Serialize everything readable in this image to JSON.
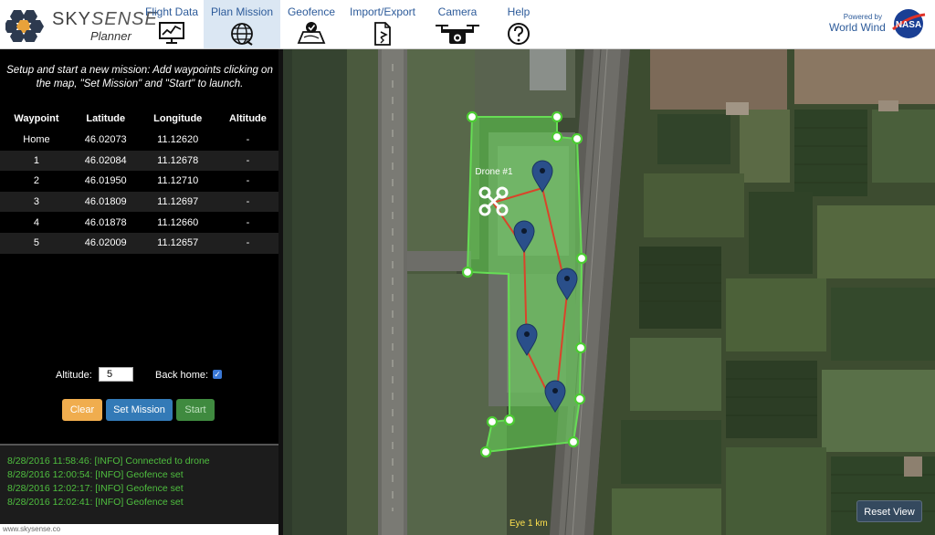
{
  "logo": {
    "brand": "SKY",
    "brand_italic": "SENSE",
    "subtitle": "Planner"
  },
  "nav": [
    {
      "label": "Flight Data",
      "icon": "chart-icon"
    },
    {
      "label": "Plan Mission",
      "icon": "globe-icon"
    },
    {
      "label": "Geofence",
      "icon": "map-check-icon"
    },
    {
      "label": "Import/Export",
      "icon": "document-arrow-icon"
    },
    {
      "label": "Camera",
      "icon": "drone-camera-icon"
    },
    {
      "label": "Help",
      "icon": "question-icon"
    }
  ],
  "powered": {
    "small": "Powered by",
    "name": "World Wind",
    "logo_text": "NASA"
  },
  "instructions": "Setup and start a new mission: Add waypoints clicking on the map, \"Set Mission\" and \"Start\" to launch.",
  "table": {
    "headers": [
      "Waypoint",
      "Latitude",
      "Longitude",
      "Altitude"
    ],
    "rows": [
      [
        "Home",
        "46.02073",
        "11.12620",
        "-"
      ],
      [
        "1",
        "46.02084",
        "11.12678",
        "-"
      ],
      [
        "2",
        "46.01950",
        "11.12710",
        "-"
      ],
      [
        "3",
        "46.01809",
        "11.12697",
        "-"
      ],
      [
        "4",
        "46.01878",
        "11.12660",
        "-"
      ],
      [
        "5",
        "46.02009",
        "11.12657",
        "-"
      ]
    ]
  },
  "controls": {
    "altitude_label": "Altitude:",
    "altitude_value": "5",
    "back_home_label": "Back home:",
    "back_home_checked": true,
    "clear_label": "Clear",
    "set_mission_label": "Set Mission",
    "start_label": "Start"
  },
  "log": [
    "8/28/2016 11:58:46: [INFO] Connected to drone",
    "8/28/2016 12:00:54: [INFO] Geofence set",
    "8/28/2016 12:02:17: [INFO] Geofence set",
    "8/28/2016 12:02:41: [INFO] Geofence set"
  ],
  "statusbar": "www.skysense.co",
  "map": {
    "drone_label": "Drone #1",
    "eye_label": "Eye  1 km",
    "reset_view_label": "Reset View"
  },
  "colors": {
    "nav_text": "#2d5b9a",
    "nav_active_bg": "#dbe7f3",
    "geofence": "#66dd55",
    "route": "#d9442a",
    "marker": "#2a4f8a",
    "clear": "#f0ad4e",
    "set_mission": "#337ab7",
    "start": "#3f8a3f",
    "log_text": "#4fbf3f"
  }
}
